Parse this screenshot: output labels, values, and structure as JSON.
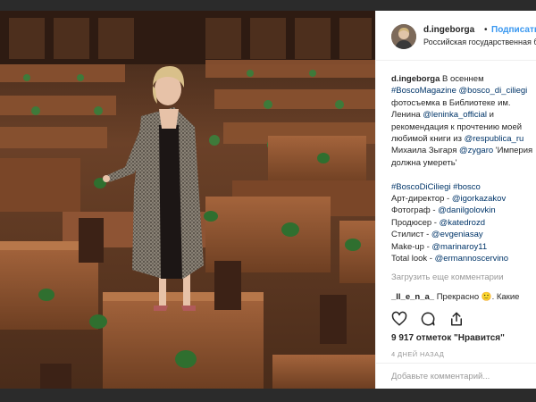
{
  "post": {
    "username": "d.ingeborga",
    "separator": "•",
    "follow_label": "Подписаться",
    "location": "Российская государственная биб...",
    "caption": {
      "username": "d.ingeborga",
      "p1": " В осеннем ",
      "tag1": "#BoscoMagazine",
      "p2": " ",
      "tag2": "@bosco_di_ciliegi",
      "p3": " фотосъемка в Библиотеке им. Ленина ",
      "tag3": "@leninka_official",
      "p4": " и рекомендация к прочтению моей любимой книги из ",
      "tag4": "@respublica_ru",
      "p5": " Михаила Зыгаря ",
      "tag5": "@zygaro",
      "p6": " 'Империя должна умереть'"
    },
    "credits": [
      {
        "prefix": "",
        "tag": "#BoscoDiCiliegi",
        "mid": " ",
        "tag2": "#bosco"
      },
      {
        "prefix": "Арт-директор - ",
        "tag": "@igorkazakov"
      },
      {
        "prefix": "Фотограф - ",
        "tag": "@danilgolovkin"
      },
      {
        "prefix": "Продюсер - ",
        "tag": "@katedrozd"
      },
      {
        "prefix": "Стилист - ",
        "tag": "@evgeniasay"
      },
      {
        "prefix": "Make-up - ",
        "tag": "@marinaroy11"
      },
      {
        "prefix": "Total look - ",
        "tag": "@ermannoscervino"
      }
    ],
    "load_more": "Загрузить еще комментарии",
    "comment": {
      "username": "_Il_e_n_a_",
      "text": " Прекрасно 🙂. Какие вокруг этой сессии крики ни о чём. Даже смешно."
    },
    "likes": "9 917 отметок \"Нравится\"",
    "time": "4 ДНЕЙ НАЗАД",
    "add_comment_placeholder": "Добавьте комментарий..."
  },
  "icons": {
    "like": "heart-icon",
    "comment": "comment-icon",
    "share": "share-icon"
  },
  "colors": {
    "link": "#003569",
    "follow": "#3897f0",
    "muted": "#999999",
    "text": "#262626"
  }
}
